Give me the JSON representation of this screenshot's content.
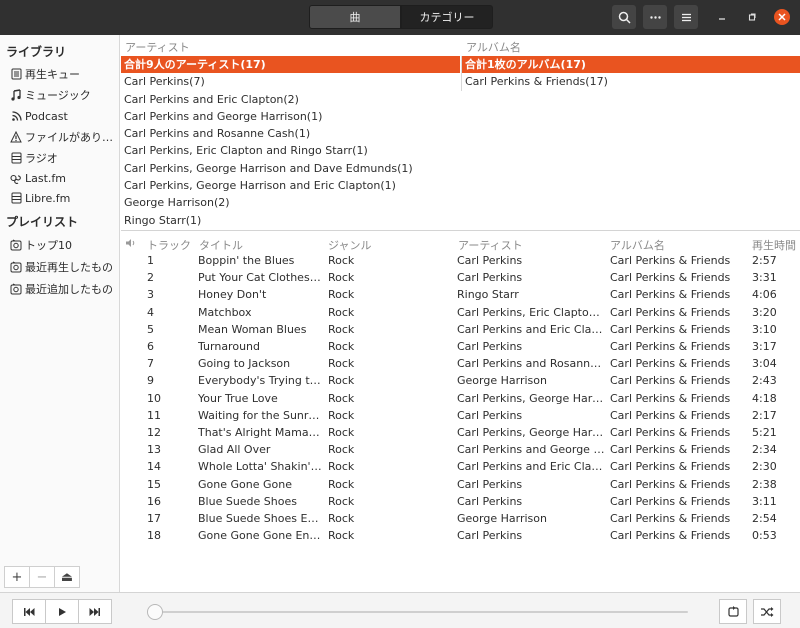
{
  "header": {
    "tab_songs": "曲",
    "tab_categories": "カテゴリー"
  },
  "sidebar": {
    "library_heading": "ライブラリ",
    "library_items": [
      {
        "label": "再生キュー",
        "icon": "queue-icon"
      },
      {
        "label": "ミュージック",
        "icon": "music-note-icon"
      },
      {
        "label": "Podcast",
        "icon": "podcast-icon"
      },
      {
        "label": "ファイルがあり…",
        "icon": "warning-icon"
      },
      {
        "label": "ラジオ",
        "icon": "radio-icon"
      },
      {
        "label": "Last.fm",
        "icon": "lastfm-icon"
      },
      {
        "label": "Libre.fm",
        "icon": "librefm-icon"
      }
    ],
    "playlist_heading": "プレイリスト",
    "playlist_items": [
      {
        "label": "トップ10",
        "icon": "auto-playlist-icon"
      },
      {
        "label": "最近再生したもの",
        "icon": "auto-playlist-icon"
      },
      {
        "label": "最近追加したもの",
        "icon": "auto-playlist-icon"
      }
    ],
    "toolbar": {
      "add": "+",
      "remove": "−",
      "eject": "⏏"
    }
  },
  "browser": {
    "artist_header": "アーティスト",
    "album_header": "アルバム名",
    "artists": [
      "合計9人のアーティスト(17)",
      "Carl Perkins(7)",
      "Carl Perkins and Eric Clapton(2)",
      "Carl Perkins and George Harrison(1)",
      "Carl Perkins and Rosanne Cash(1)",
      "Carl Perkins, Eric Clapton and Ringo Starr(1)",
      "Carl Perkins, George Harrison and Dave Edmunds(1)",
      "Carl Perkins, George Harrison and Eric Clapton(1)",
      "George Harrison(2)",
      "Ringo Starr(1)"
    ],
    "albums": [
      "合計1枚のアルバム(17)",
      "Carl Perkins & Friends(17)"
    ]
  },
  "tracks": {
    "headers": {
      "track": "トラック",
      "title": "タイトル",
      "genre": "ジャンル",
      "artist": "アーティスト",
      "album": "アルバム名",
      "duration": "再生時間"
    },
    "rows": [
      {
        "track": "1",
        "title": "Boppin' the Blues",
        "genre": "Rock",
        "artist": "Carl Perkins",
        "album": "Carl Perkins & Friends",
        "duration": "2:57"
      },
      {
        "track": "2",
        "title": "Put Your Cat Clothes On",
        "genre": "Rock",
        "artist": "Carl Perkins",
        "album": "Carl Perkins & Friends",
        "duration": "3:31"
      },
      {
        "track": "3",
        "title": "Honey Don't",
        "genre": "Rock",
        "artist": "Ringo Starr",
        "album": "Carl Perkins & Friends",
        "duration": "4:06"
      },
      {
        "track": "4",
        "title": "Matchbox",
        "genre": "Rock",
        "artist": "Carl Perkins, Eric Clapton a…",
        "album": "Carl Perkins & Friends",
        "duration": "3:20"
      },
      {
        "track": "5",
        "title": "Mean Woman Blues",
        "genre": "Rock",
        "artist": "Carl Perkins and Eric Clapton",
        "album": "Carl Perkins & Friends",
        "duration": "3:10"
      },
      {
        "track": "6",
        "title": "Turnaround",
        "genre": "Rock",
        "artist": "Carl Perkins",
        "album": "Carl Perkins & Friends",
        "duration": "3:17"
      },
      {
        "track": "7",
        "title": "Going to Jackson",
        "genre": "Rock",
        "artist": "Carl Perkins and Rosanne C…",
        "album": "Carl Perkins & Friends",
        "duration": "3:04"
      },
      {
        "track": "9",
        "title": "Everybody's Trying to …",
        "genre": "Rock",
        "artist": "George Harrison",
        "album": "Carl Perkins & Friends",
        "duration": "2:43"
      },
      {
        "track": "10",
        "title": "Your True Love",
        "genre": "Rock",
        "artist": "Carl Perkins, George Harris…",
        "album": "Carl Perkins & Friends",
        "duration": "4:18"
      },
      {
        "track": "11",
        "title": "Waiting for the Sunrise",
        "genre": "Rock",
        "artist": "Carl Perkins",
        "album": "Carl Perkins & Friends",
        "duration": "2:17"
      },
      {
        "track": "12",
        "title": "That's Alright Mama / …",
        "genre": "Rock",
        "artist": "Carl Perkins, George Harris…",
        "album": "Carl Perkins & Friends",
        "duration": "5:21"
      },
      {
        "track": "13",
        "title": "Glad All Over",
        "genre": "Rock",
        "artist": "Carl Perkins and George Ha…",
        "album": "Carl Perkins & Friends",
        "duration": "2:34"
      },
      {
        "track": "14",
        "title": "Whole Lotta' Shakin' g…",
        "genre": "Rock",
        "artist": "Carl Perkins and Eric Clapton",
        "album": "Carl Perkins & Friends",
        "duration": "2:30"
      },
      {
        "track": "15",
        "title": "Gone Gone Gone",
        "genre": "Rock",
        "artist": "Carl Perkins",
        "album": "Carl Perkins & Friends",
        "duration": "2:38"
      },
      {
        "track": "16",
        "title": "Blue Suede Shoes",
        "genre": "Rock",
        "artist": "Carl Perkins",
        "album": "Carl Perkins & Friends",
        "duration": "3:11"
      },
      {
        "track": "17",
        "title": "Blue Suede Shoes Encore",
        "genre": "Rock",
        "artist": "George Harrison",
        "album": "Carl Perkins & Friends",
        "duration": "2:54"
      },
      {
        "track": "18",
        "title": "Gone Gone Gone Encore",
        "genre": "Rock",
        "artist": "Carl Perkins",
        "album": "Carl Perkins & Friends",
        "duration": "0:53"
      }
    ]
  },
  "player": {
    "progress": 0
  },
  "colors": {
    "accent": "#e95420",
    "header_bg": "#303030"
  }
}
